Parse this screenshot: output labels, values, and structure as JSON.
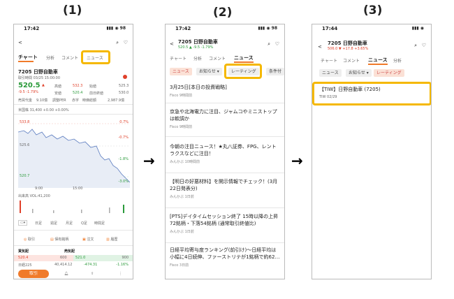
{
  "labels": {
    "p1": "(1)",
    "p2": "(2)",
    "p3": "(3)"
  },
  "arrow": "→",
  "p1": {
    "time": "17:42",
    "status_icons": "▮▮▮ ◉ 98",
    "tabs": [
      "チャート",
      "分析",
      "コメント",
      "ニュース"
    ],
    "stock_name": "7205 日野自動車",
    "sub_info": "取引時間 03/25 15:00:00",
    "price": "520.5",
    "price_arrow": "▲",
    "change": "-9.5 -1.79%",
    "stats": [
      [
        "高値",
        "532.3",
        "始値",
        "525.3"
      ],
      [
        "安値",
        "520.4",
        "前日終値",
        "530.0"
      ],
      [
        "売買代金",
        "9.10億",
        "調整PER",
        "赤字",
        "時価総額",
        "2,987.9億"
      ]
    ],
    "index_row": "米国株 31,400 +0.00 +0.00%",
    "chart_ticks": [
      "533.8",
      "525.6",
      "520.7"
    ],
    "chart_pct": [
      "0.7%",
      "-0.7%",
      "-1.8%",
      "-3.0%"
    ],
    "chart_x": [
      "9:00",
      "15:00"
    ],
    "volume_label": "出来高 VOL:41,200",
    "period_buttons": [
      "日足",
      "週足",
      "月足",
      "Q足",
      "時間足"
    ],
    "actions": [
      "取引",
      "保有銘柄",
      "注文",
      "履歴"
    ],
    "board_title": "買気配",
    "board_title2": "売気配",
    "board_rows": [
      [
        "520.4",
        "600",
        "521.0",
        "900"
      ],
      [
        "日経225",
        "40,414.12",
        "-474.31",
        "-1.16%"
      ]
    ],
    "trade_button": "取引"
  },
  "p2": {
    "time": "17:42",
    "status_icons": "▮▮▮ ◉ 98",
    "stock_name": "7205 日野自動車",
    "price_line": "520.5 ▲ -9.5 -1.79%",
    "tabs": [
      "チャート",
      "分析",
      "コメント",
      "ニュース"
    ],
    "chips": [
      "ニュース",
      "お知らせ ▾",
      "レーティング",
      "条件付"
    ],
    "news": [
      {
        "title": "3月25日[本日の投資戦略]",
        "src": "Fisco 9時間前"
      },
      {
        "title": "京急や北海電力に注目、ジャムコやミニストップは軟調か",
        "src": "Fisco 9時間前"
      },
      {
        "title": "今朝の注目ニュース！★丸八証券、FPG、レントラクスなどに注目！",
        "src": "みんかぶ 10時間前"
      },
      {
        "title": "【明日の好悪材料】を開示情報でチェック！(3月22日発表分)",
        "src": "みんかぶ 1日前"
      },
      {
        "title": "[PTS]デイタイムセッション終了 15時以降の上昇72銘柄・下落54銘柄 (通常取引終値比)",
        "src": "みんかぶ 1日前"
      },
      {
        "title": "日経平均寄与度ランキング(前引け)～日経平均は小幅に4日続伸、ファーストリテが1銘柄で約62…",
        "src": "Fisco 3日前"
      }
    ]
  },
  "p3": {
    "time": "17:44",
    "status_icons": "▮▮▮ ◉",
    "stock_name": "7205 日野自動車",
    "price_line": "506.0 ▼ +17.8 +3.65%",
    "tabs": [
      "チャート",
      "コメント",
      "ニュース",
      "分析"
    ],
    "chips": [
      "ニュース",
      "お知らせ ▾",
      "レーティング"
    ],
    "rating_title": "【TIW】日野自動車 (7205)",
    "rating_sub": "TIW 02/29"
  },
  "colors": {
    "highlight": "#f5b800",
    "up": "#e0402a",
    "down": "#2a9a3a",
    "accent": "#f07a2a"
  }
}
